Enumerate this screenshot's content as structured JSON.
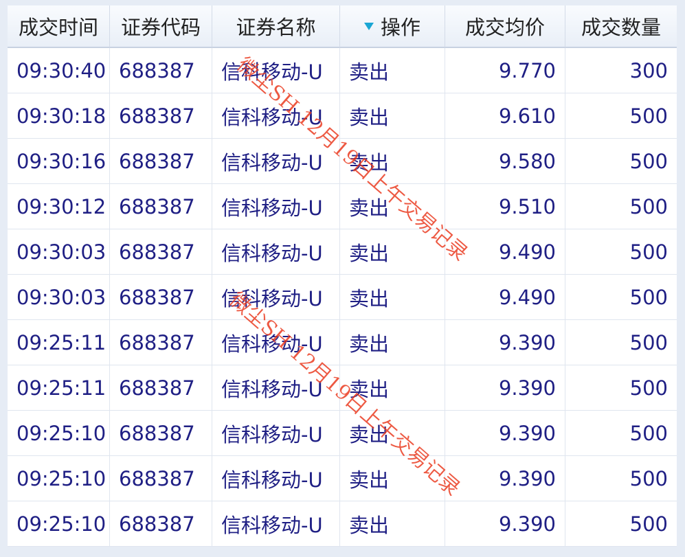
{
  "columns": [
    "成交时间",
    "证券代码",
    "证券名称",
    "操作",
    "成交均价",
    "成交数量"
  ],
  "sorted_column_icon": "sort-down-triangle-icon",
  "accent_color": "#1aa6d4",
  "text_color": "#1f1f84",
  "rows": [
    {
      "time": "09:30:40",
      "code": "688387",
      "name": "信科移动-U",
      "action": "卖出",
      "price": "9.770",
      "qty": "300"
    },
    {
      "time": "09:30:18",
      "code": "688387",
      "name": "信科移动-U",
      "action": "卖出",
      "price": "9.610",
      "qty": "500"
    },
    {
      "time": "09:30:16",
      "code": "688387",
      "name": "信科移动-U",
      "action": "卖出",
      "price": "9.580",
      "qty": "500"
    },
    {
      "time": "09:30:12",
      "code": "688387",
      "name": "信科移动-U",
      "action": "卖出",
      "price": "9.510",
      "qty": "500"
    },
    {
      "time": "09:30:03",
      "code": "688387",
      "name": "信科移动-U",
      "action": "卖出",
      "price": "9.490",
      "qty": "500"
    },
    {
      "time": "09:30:03",
      "code": "688387",
      "name": "信科移动-U",
      "action": "卖出",
      "price": "9.490",
      "qty": "500"
    },
    {
      "time": "09:25:11",
      "code": "688387",
      "name": "信科移动-U",
      "action": "卖出",
      "price": "9.390",
      "qty": "500"
    },
    {
      "time": "09:25:11",
      "code": "688387",
      "name": "信科移动-U",
      "action": "卖出",
      "price": "9.390",
      "qty": "500"
    },
    {
      "time": "09:25:10",
      "code": "688387",
      "name": "信科移动-U",
      "action": "卖出",
      "price": "9.390",
      "qty": "500"
    },
    {
      "time": "09:25:10",
      "code": "688387",
      "name": "信科移动-U",
      "action": "卖出",
      "price": "9.390",
      "qty": "500"
    },
    {
      "time": "09:25:10",
      "code": "688387",
      "name": "信科移动-U",
      "action": "卖出",
      "price": "9.390",
      "qty": "500"
    }
  ],
  "watermarks": [
    "微尘SH 12月19日上午交易记录",
    "微尘SH 12月19日上午交易记录"
  ]
}
